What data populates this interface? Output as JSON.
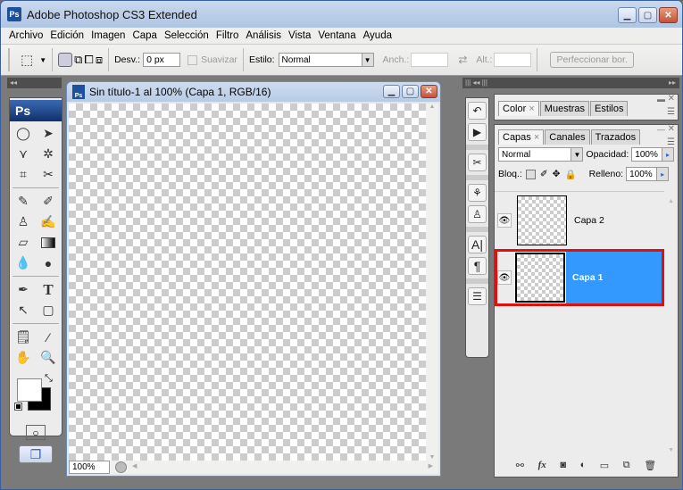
{
  "app": {
    "title": "Adobe Photoshop CS3 Extended",
    "logo": "Ps"
  },
  "menu": [
    "Archivo",
    "Edición",
    "Imagen",
    "Capa",
    "Selección",
    "Filtro",
    "Análisis",
    "Vista",
    "Ventana",
    "Ayuda"
  ],
  "options": {
    "feather_label": "Desv.:",
    "feather_value": "0 px",
    "antialias_label": "Suavizar",
    "style_label": "Estilo:",
    "style_value": "Normal",
    "width_label": "Anch.:",
    "height_label": "Alt.:",
    "refine_edge_label": "Perfeccionar bor."
  },
  "toolbox": {
    "logo": "Ps"
  },
  "document": {
    "title": "Sin título-1 al 100% (Capa 1, RGB/16)",
    "zoom": "100%"
  },
  "panels": {
    "color_group_tabs": [
      "Color",
      "Muestras",
      "Estilos"
    ],
    "layers_group_tabs": [
      "Capas",
      "Canales",
      "Trazados"
    ],
    "blend_mode": "Normal",
    "opacity_label": "Opacidad:",
    "opacity_value": "100%",
    "lock_label": "Bloq.:",
    "fill_label": "Relleno:",
    "fill_value": "100%",
    "layers": [
      {
        "name": "Capa 2",
        "visible": true,
        "selected": false
      },
      {
        "name": "Capa 1",
        "visible": true,
        "selected": true
      }
    ],
    "highlight_color": "#3399ff",
    "annotation_color": "#dd1111"
  }
}
